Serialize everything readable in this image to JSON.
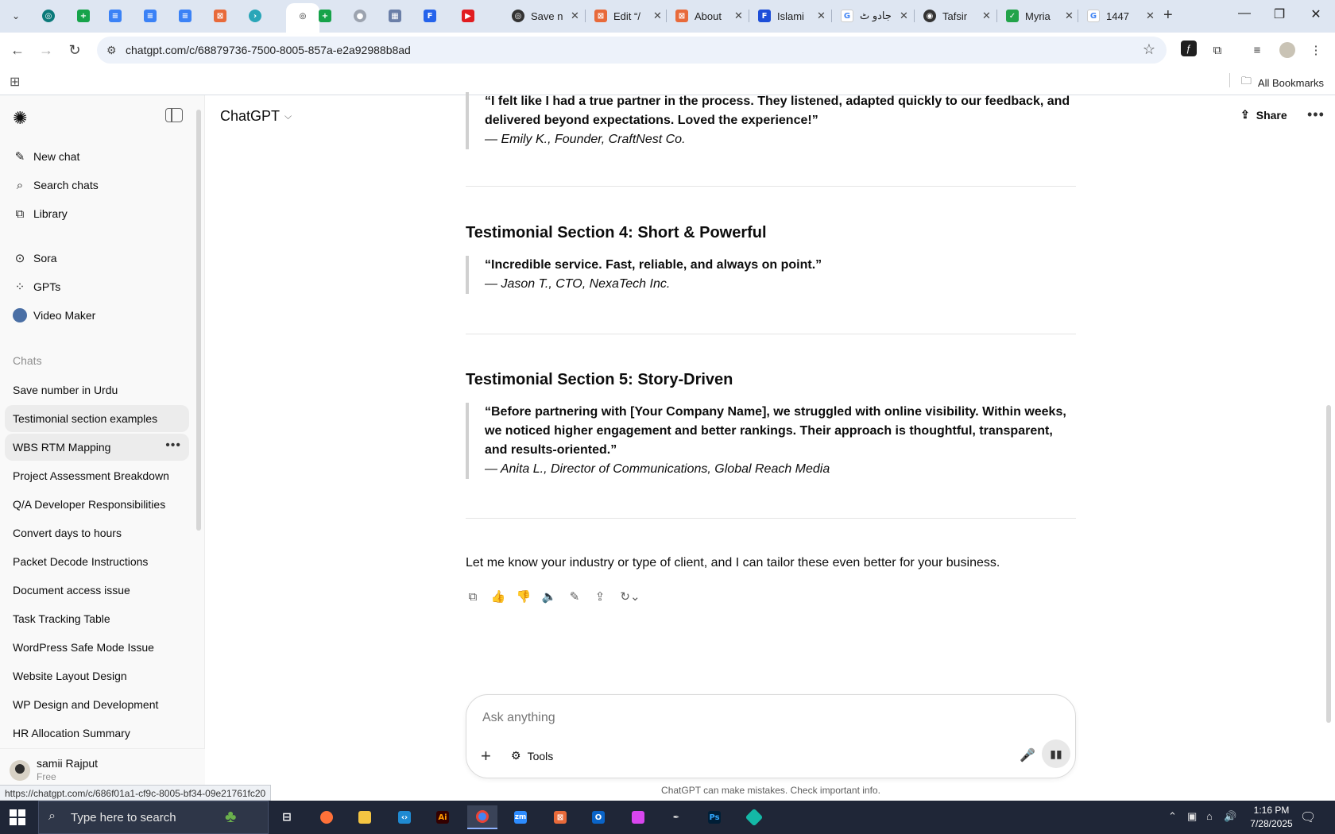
{
  "browser": {
    "tabs": [
      {
        "title": "Save n",
        "favicon": "openai-icon",
        "color": "#333333"
      },
      {
        "title": "Edit “/",
        "favicon": "bracket-box-icon",
        "color": "#e86a3a"
      },
      {
        "title": "About",
        "favicon": "bracket-box-icon",
        "color": "#e86a3a"
      },
      {
        "title": "Islami",
        "favicon": "f-icon",
        "color": "#1d4ed8"
      },
      {
        "title": "جادو ٹ",
        "favicon": "google-icon",
        "color": "#4285f4"
      },
      {
        "title": "Tafsir",
        "favicon": "dark-circle-icon",
        "color": "#333333"
      },
      {
        "title": "Myria",
        "favicon": "leaf-icon",
        "color": "#22a34a"
      },
      {
        "title": "1447",
        "favicon": "google-icon",
        "color": "#4285f4"
      }
    ],
    "url": "chatgpt.com/c/68879736-7500-8005-857a-e2a92988b8ad",
    "all_bookmarks": "All Bookmarks",
    "status_url": "https://chatgpt.com/c/686f01a1-cf9c-8005-bf34-09e21761fc20"
  },
  "sidebar": {
    "nav": [
      {
        "label": "New chat",
        "icon": "edit-icon"
      },
      {
        "label": "Search chats",
        "icon": "search-icon"
      },
      {
        "label": "Library",
        "icon": "library-icon"
      }
    ],
    "tools": [
      {
        "label": "Sora",
        "icon": "play-circle-icon"
      },
      {
        "label": "GPTs",
        "icon": "grid-icon"
      },
      {
        "label": "Video Maker",
        "icon": "video-maker-avatar"
      }
    ],
    "chats_heading": "Chats",
    "chats": [
      "Save number in Urdu",
      "Testimonial section examples",
      "WBS RTM Mapping",
      "Project Assessment Breakdown",
      "Q/A Developer Responsibilities",
      "Convert days to hours",
      "Packet Decode Instructions",
      "Document access issue",
      "Task Tracking Table",
      "WordPress Safe Mode Issue",
      "Website Layout Design",
      "WP Design and Development",
      "HR Allocation Summary"
    ],
    "user": {
      "name": "samii Rajput",
      "plan": "Free"
    }
  },
  "header": {
    "model": "ChatGPT",
    "share": "Share"
  },
  "conversation": {
    "quote_top": {
      "text": "“I felt like I had a true partner in the process. They listened, adapted quickly to our feedback, and delivered beyond expectations. Loved the experience!”",
      "author": "— Emily K., Founder, CraftNest Co."
    },
    "section4": {
      "heading": "Testimonial Section 4: Short & Powerful",
      "text": "“Incredible service. Fast, reliable, and always on point.”",
      "author": "— Jason T., CTO, NexaTech Inc."
    },
    "section5": {
      "heading": "Testimonial Section 5: Story-Driven",
      "text": "“Before partnering with [Your Company Name], we struggled with online visibility. Within weeks, we noticed higher engagement and better rankings. Their approach is thoughtful, transparent, and results-oriented.”",
      "author": "— Anita L., Director of Communications, Global Reach Media"
    },
    "closing": "Let me know your industry or type of client, and I can tailor these even better for your business."
  },
  "composer": {
    "placeholder": "Ask anything",
    "tools": "Tools",
    "disclaimer": "ChatGPT can make mistakes. Check important info."
  },
  "taskbar": {
    "search_placeholder": "Type here to search",
    "time": "1:16 PM",
    "date": "7/28/2025"
  }
}
